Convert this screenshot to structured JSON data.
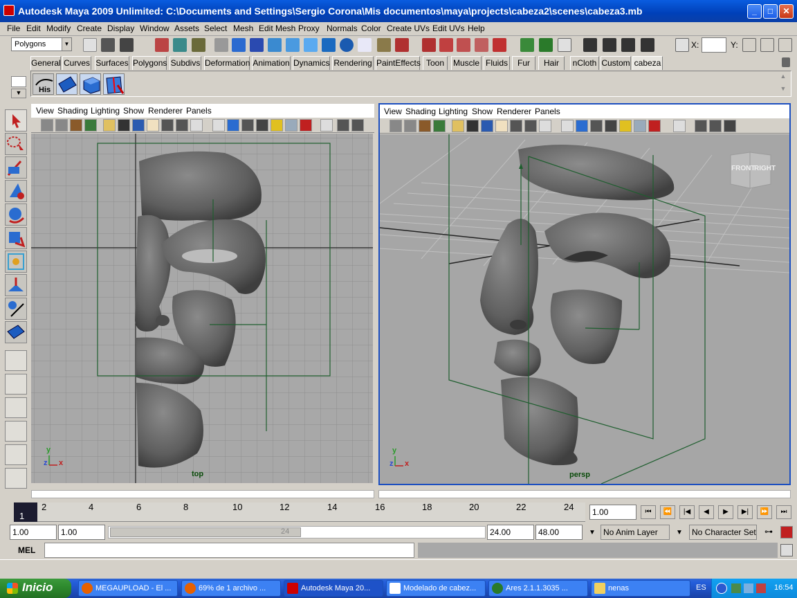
{
  "window": {
    "title": "Autodesk Maya 2009 Unlimited: C:\\Documents and Settings\\Sergio Corona\\Mis documentos\\maya\\projects\\cabeza2\\scenes\\cabeza3.mb",
    "minimize": "_",
    "maximize": "□",
    "close": "✕"
  },
  "menubar": [
    "File",
    "Edit",
    "Modify",
    "Create",
    "Display",
    "Window",
    "Assets",
    "Select",
    "Mesh",
    "Edit Mesh",
    "Proxy",
    "Normals",
    "Color",
    "Create UVs",
    "Edit UVs",
    "Help"
  ],
  "statusline": {
    "mode": "Polygons",
    "x_label": "X:",
    "y_label": "Y:"
  },
  "shelf_tabs": [
    "General",
    "Curves",
    "Surfaces",
    "Polygons",
    "Subdivs",
    "Deformation",
    "Animation",
    "Dynamics",
    "Rendering",
    "PaintEffects",
    "Toon",
    "Muscle",
    "Fluids",
    "Fur",
    "Hair",
    "nCloth",
    "Custom",
    "cabeza"
  ],
  "shelf_active": "cabeza",
  "shelf_first_label": "His",
  "panels": {
    "left": {
      "menu": [
        "View",
        "Shading",
        "Lighting",
        "Show",
        "Renderer",
        "Panels"
      ],
      "camera": "top"
    },
    "right": {
      "menu": [
        "View",
        "Shading",
        "Lighting",
        "Show",
        "Renderer",
        "Panels"
      ],
      "camera": "persp",
      "viewcube_front": "FRONT",
      "viewcube_right": "RIGHT"
    }
  },
  "axis": {
    "y": "y",
    "z": "z",
    "x": "x"
  },
  "timeslider": {
    "ticks": [
      "2",
      "4",
      "6",
      "8",
      "10",
      "12",
      "14",
      "16",
      "18",
      "20",
      "22",
      "24"
    ],
    "current_frame": "1",
    "current_field": "1.00"
  },
  "range": {
    "start": "1.00",
    "playback_start": "1.00",
    "playback_end": "24.00",
    "end": "48.00",
    "slider_label": "24",
    "anim_layer": "No Anim Layer",
    "character_set": "No Character Set"
  },
  "cmdline": {
    "label": "MEL"
  },
  "taskbar": {
    "start": "Inicio",
    "items": [
      "MEGAUPLOAD - El ...",
      "69% de 1 archivo ...",
      "Autodesk Maya 20...",
      "Modelado de cabez...",
      "Ares 2.1.1.3035  ...",
      "nenas"
    ],
    "active_index": 2,
    "language": "ES",
    "clock": "16:54"
  },
  "colors": {
    "title_blue": "#0a5de0",
    "viewport_bg": "#a8a8a8",
    "active_panel_border": "#1c4fc0",
    "frame_line": "#1e5e2e"
  }
}
